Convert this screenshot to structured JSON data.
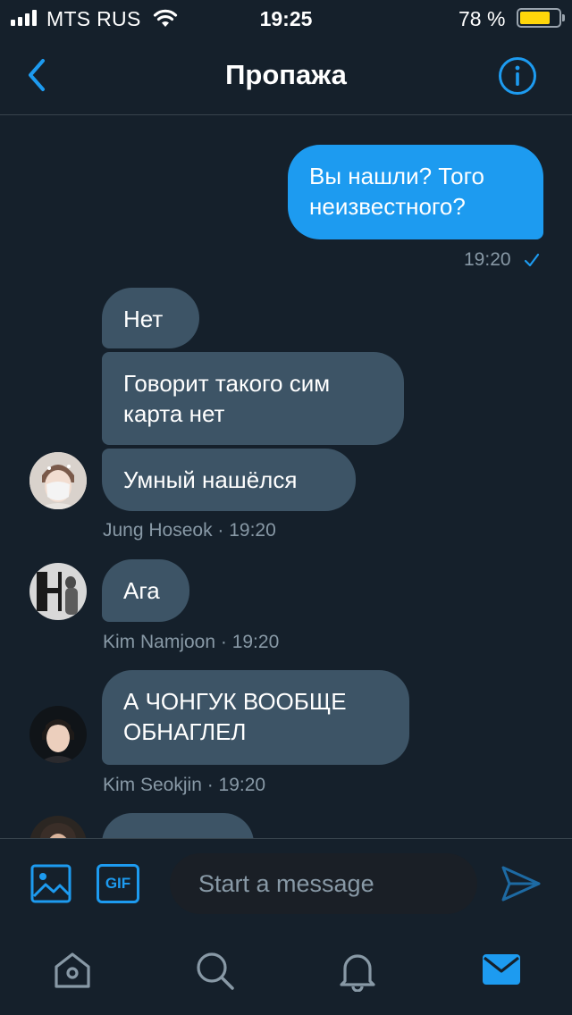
{
  "status_bar": {
    "carrier": "MTS RUS",
    "time": "19:25",
    "battery_pct": "78 %",
    "battery_level": 0.78,
    "signal_bars": 4
  },
  "header": {
    "title": "Пропажа",
    "back_icon": "chevron-left-icon",
    "info_icon": "info-icon"
  },
  "messages": {
    "out1": {
      "text": "Вы нашли? Того неизвестного?",
      "time": "19:20"
    },
    "g1_msg1": "Нет",
    "g1_msg2": "Говорит такого сим карта нет",
    "g1_msg3": "Умный нашёлся",
    "g1_meta": "Jung Hoseok · 19:20",
    "g2_msg1": "Ага",
    "g2_meta": "Kim Namjoon · 19:20",
    "g3_msg1": "А ЧОНГУК ВООБЩЕ ОБНАГЛЕЛ",
    "g3_meta": "Kim Seokjin · 19:20"
  },
  "composer": {
    "placeholder": "Start a message",
    "gif_label": "GIF",
    "image_icon": "image-icon",
    "send_icon": "send-icon"
  },
  "tabs": {
    "home_icon": "home-icon",
    "search_icon": "search-icon",
    "notifications_icon": "bell-icon",
    "messages_icon": "mail-icon",
    "active": "messages"
  },
  "colors": {
    "background": "#15202b",
    "accent": "#1d9bf0",
    "incoming_bubble": "#3d5466",
    "meta_text": "#8899a6",
    "battery": "#ffd60a"
  }
}
